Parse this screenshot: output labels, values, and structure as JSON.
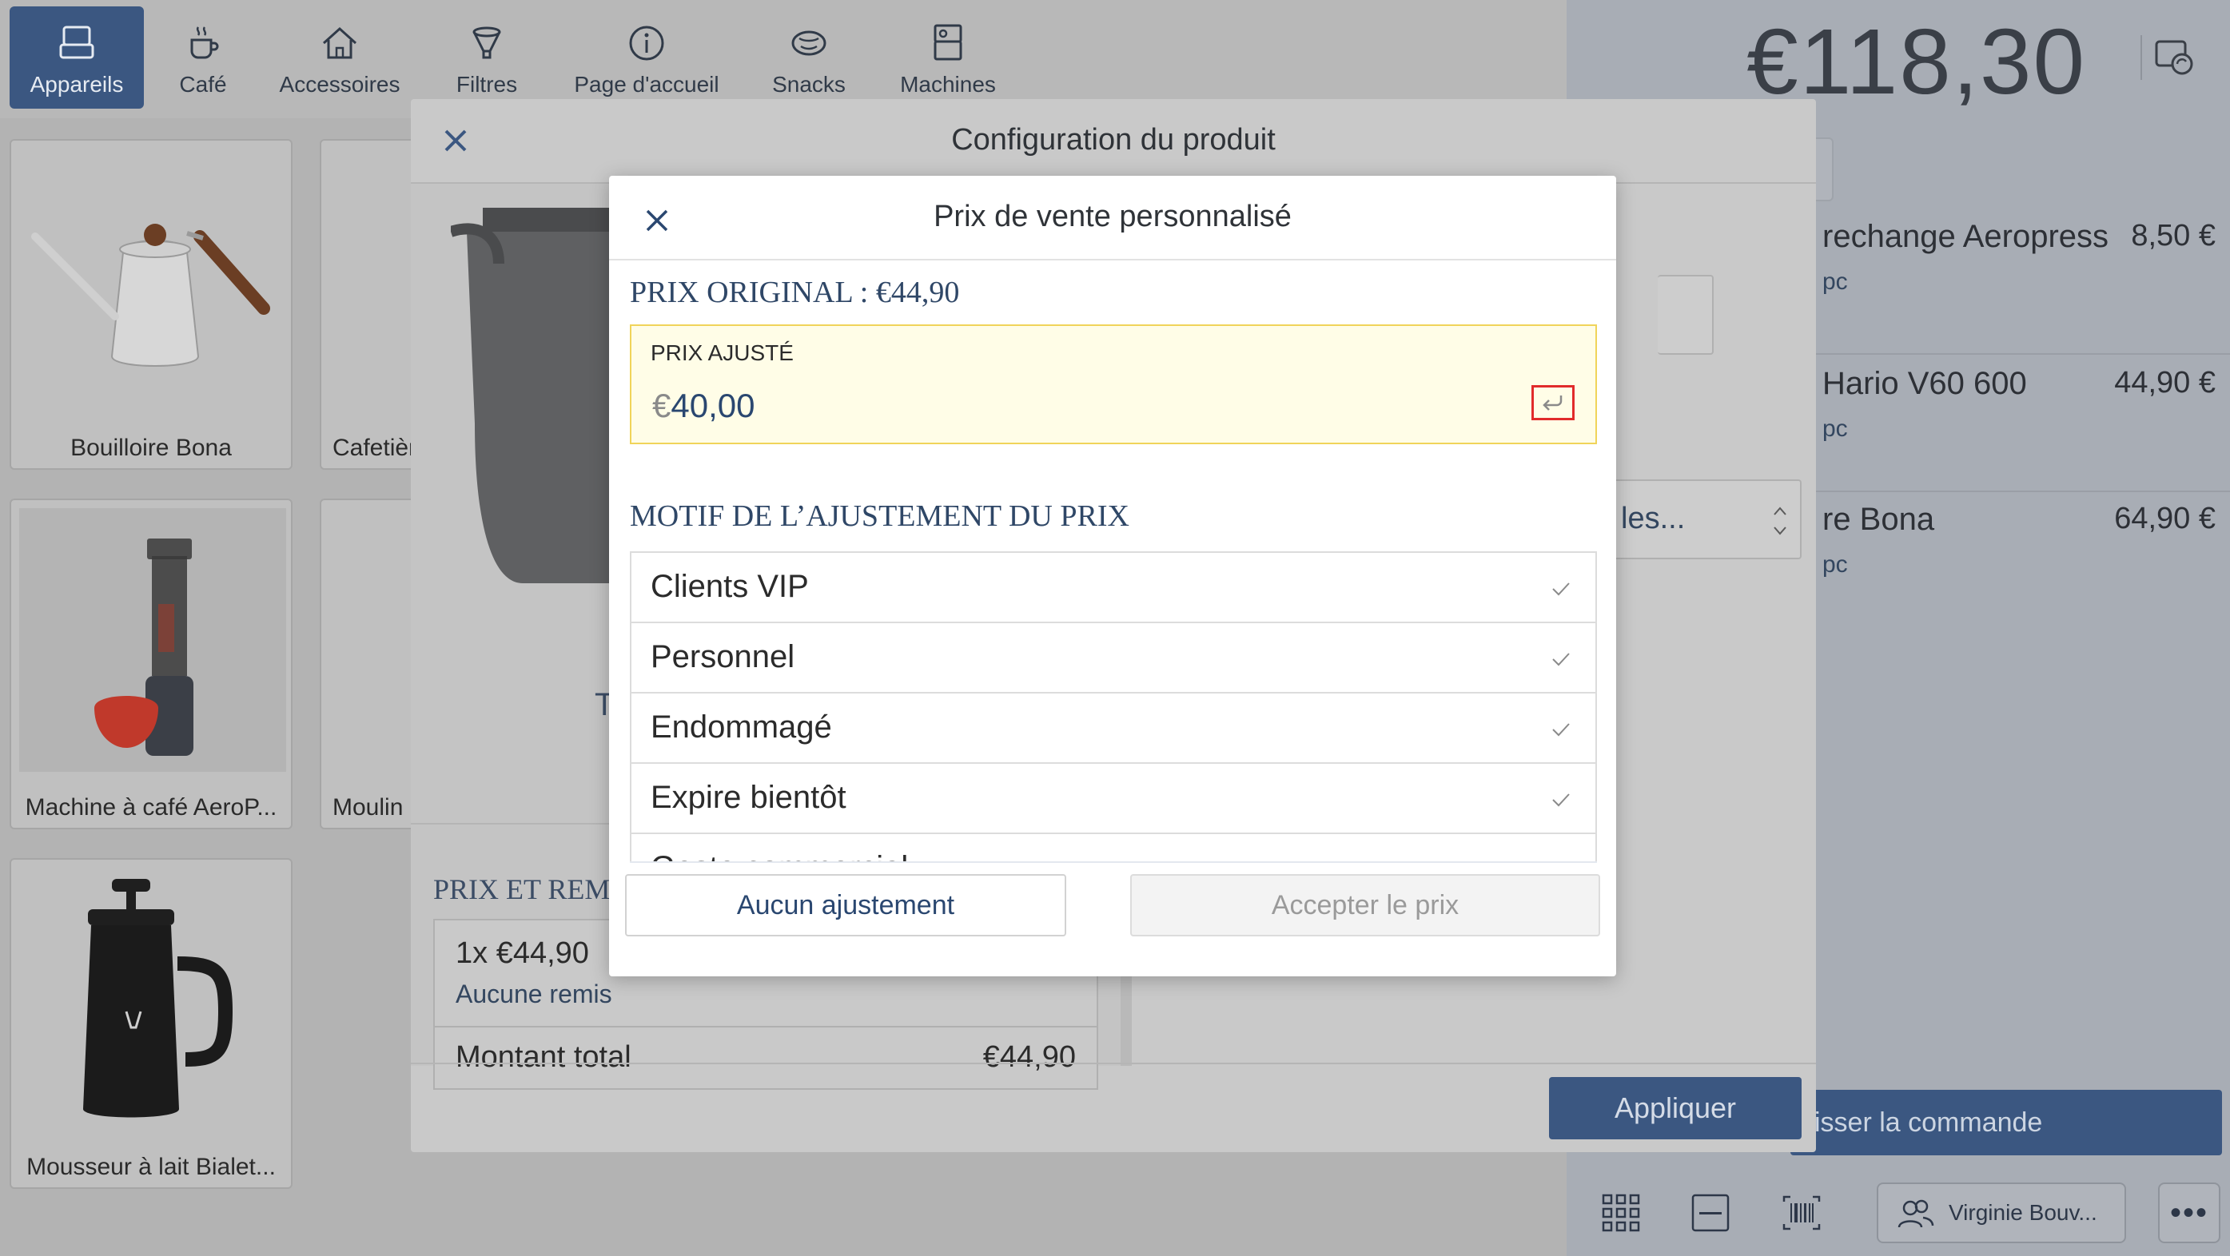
{
  "tabs": [
    {
      "label": "Appareils",
      "icon": "device-icon",
      "active": true
    },
    {
      "label": "Café",
      "icon": "coffee-cup-icon"
    },
    {
      "label": "Accessoires",
      "icon": "home-icon"
    },
    {
      "label": "Filtres",
      "icon": "filter-icon"
    },
    {
      "label": "Page d'accueil",
      "icon": "info-icon"
    },
    {
      "label": "Snacks",
      "icon": "snack-icon"
    },
    {
      "label": "Machines",
      "icon": "machine-icon"
    }
  ],
  "products": [
    {
      "name": "Bouilloire Bona"
    },
    {
      "name": "Cafetièr"
    },
    {
      "name": "Machine à café AeroP..."
    },
    {
      "name": "Moulin"
    },
    {
      "name": "Mousseur à lait Bialet..."
    }
  ],
  "cart": {
    "total": "€118,30",
    "lines": [
      {
        "title": "rechange Aeropress",
        "price": "8,50 €",
        "sub": "pc"
      },
      {
        "title": "Hario V60 600",
        "price": "44,90 €",
        "sub": "pc"
      },
      {
        "title": "re Bona",
        "price": "64,90 €",
        "sub": "pc"
      }
    ],
    "dropdown_text": "les...",
    "order_button": "isser la commande",
    "customer_button": "Virginie Bouv...",
    "more_label": "•••"
  },
  "product_config": {
    "title": "Configuration du produit",
    "product_letter": "T",
    "section_title": "PRIX ET REMIS",
    "price_line": "1x €44,90",
    "discount_text": "Aucune remis",
    "total_label": "Montant total",
    "total_value": "€44,90",
    "apply_button": "Appliquer"
  },
  "custom_price": {
    "title": "Prix de vente personnalisé",
    "original_price": "PRIX ORIGINAL : €44,90",
    "adjusted_label": "PRIX AJUSTÉ",
    "currency": "€",
    "adjusted_value": "40,00",
    "reason_title": "MOTIF DE L’AJUSTEMENT DU PRIX",
    "reasons": [
      "Clients VIP",
      "Personnel",
      "Endommagé",
      "Expire bientôt",
      "Geste commercial"
    ],
    "no_adjust_button": "Aucun ajustement",
    "accept_button": "Accepter le prix"
  },
  "colors": {
    "accent": "#3b5781",
    "highlight_box": "#fffde7",
    "highlight_border": "#f0d45a",
    "focus_red": "#e12b2b"
  }
}
